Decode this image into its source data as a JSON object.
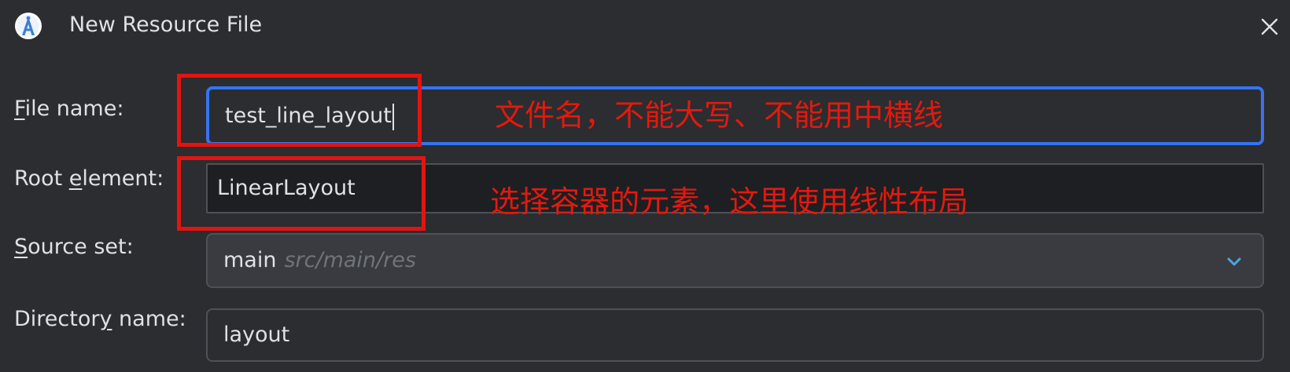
{
  "window": {
    "title": "New Resource File",
    "app_icon": "android-studio-icon",
    "close_icon": "close-icon"
  },
  "form": {
    "file_name": {
      "label_prefix": "",
      "label_mnemonic": "F",
      "label_suffix": "ile name:",
      "value": "test_line_layout"
    },
    "root_element": {
      "label_prefix": "Root ",
      "label_mnemonic": "e",
      "label_suffix": "lement:",
      "value": "LinearLayout"
    },
    "source_set": {
      "label_prefix": "",
      "label_mnemonic": "S",
      "label_suffix": "ource set:",
      "value": "main",
      "path_hint": "src/main/res",
      "dropdown_icon": "chevron-down-icon"
    },
    "directory_name": {
      "label_prefix": "Director",
      "label_mnemonic": "y",
      "label_suffix": " name:",
      "value": "layout"
    }
  },
  "annotations": {
    "file_name_note": "文件名，不能大写、不能用中横线",
    "root_element_note": "选择容器的元素，这里使用线性布局"
  },
  "colors": {
    "background": "#2b2d30",
    "focus_border": "#3574f0",
    "annotation_red": "#e5130f",
    "chevron_blue": "#4aa6e8"
  }
}
